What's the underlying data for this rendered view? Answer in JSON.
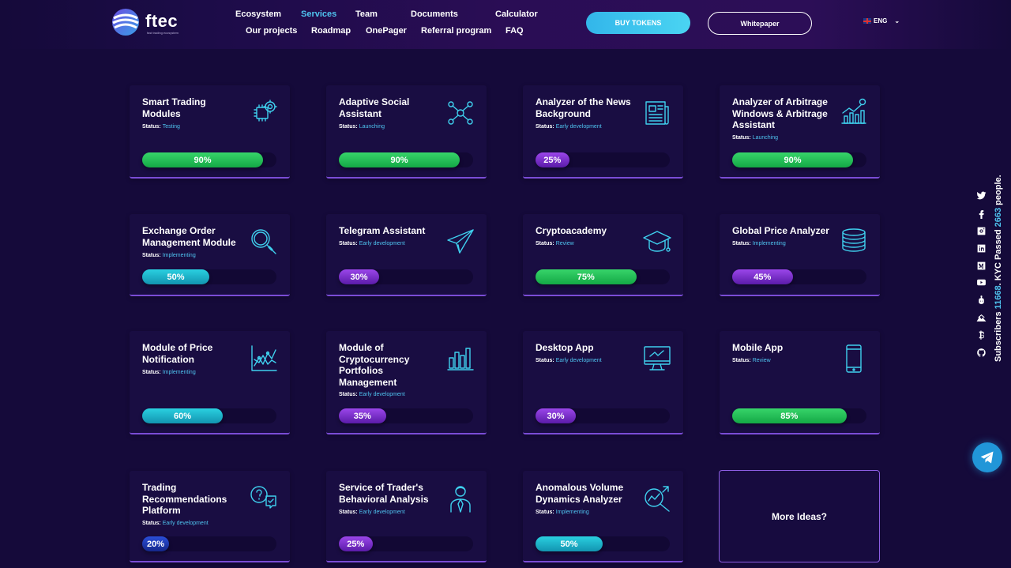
{
  "header": {
    "logo_text": "ftec",
    "logo_sub": "fast trading ecosystem",
    "nav": [
      {
        "label": "Ecosystem",
        "active": false
      },
      {
        "label": "Services",
        "active": true
      },
      {
        "label": "Team",
        "active": false
      },
      {
        "label": "Documents",
        "active": false
      },
      {
        "label": "Calculator",
        "active": false
      },
      {
        "label": "Our projects",
        "active": false
      },
      {
        "label": "Roadmap",
        "active": false
      },
      {
        "label": "OnePager",
        "active": false
      },
      {
        "label": "Referral program",
        "active": false
      },
      {
        "label": "FAQ",
        "active": false
      }
    ],
    "buy_label": "BUY TOKENS",
    "whitepaper_label": "Whitepaper",
    "lang": "ENG"
  },
  "status_prefix": "Status:",
  "cards": [
    {
      "title": "Smart Trading Modules",
      "status": "Testing",
      "progress": 90,
      "progress_label": "90%",
      "color": "green",
      "icon": "chip-gear-icon"
    },
    {
      "title": "Adaptive Social Assistant",
      "status": "Launching",
      "progress": 90,
      "progress_label": "90%",
      "color": "green",
      "icon": "network-icon"
    },
    {
      "title": "Analyzer of the News Background",
      "status": "Early development",
      "progress": 25,
      "progress_label": "25%",
      "color": "purple",
      "icon": "newspaper-icon"
    },
    {
      "title": "Analyzer of Arbitrage Windows & Arbitrage Assistant",
      "status": "Launching",
      "progress": 90,
      "progress_label": "90%",
      "color": "green",
      "icon": "growth-chart-icon"
    },
    {
      "title": "Exchange Order Management Module",
      "status": "Implementing",
      "progress": 50,
      "progress_label": "50%",
      "color": "cyan",
      "icon": "magnifier-icon"
    },
    {
      "title": "Telegram Assistant",
      "status": "Early development",
      "progress": 30,
      "progress_label": "30%",
      "color": "purple",
      "icon": "paper-plane-icon"
    },
    {
      "title": "Cryptoacademy",
      "status": "Review",
      "progress": 75,
      "progress_label": "75%",
      "color": "green",
      "icon": "graduation-cap-icon"
    },
    {
      "title": "Global Price Analyzer",
      "status": "Implementing",
      "progress": 45,
      "progress_label": "45%",
      "color": "purple",
      "icon": "coins-icon"
    },
    {
      "title": "Module of Price Notification",
      "status": "Implementing",
      "progress": 60,
      "progress_label": "60%",
      "color": "cyan",
      "icon": "line-chart-icon"
    },
    {
      "title": "Module of Cryptocurrency Portfolios Management",
      "status": "Early development",
      "progress": 35,
      "progress_label": "35%",
      "color": "purple",
      "icon": "bar-chart-icon"
    },
    {
      "title": "Desktop App",
      "status": "Early development",
      "progress": 30,
      "progress_label": "30%",
      "color": "purple",
      "icon": "monitor-icon"
    },
    {
      "title": "Mobile App",
      "status": "Review",
      "progress": 85,
      "progress_label": "85%",
      "color": "green",
      "icon": "smartphone-icon"
    },
    {
      "title": "Trading Recommendations Platform",
      "status": "Early development",
      "progress": 20,
      "progress_label": "20%",
      "color": "blue",
      "icon": "chat-question-icon"
    },
    {
      "title": "Service of Trader's Behavioral Analysis",
      "status": "Early development",
      "progress": 25,
      "progress_label": "25%",
      "color": "purple",
      "icon": "person-icon"
    },
    {
      "title": "Anomalous Volume Dynamics Analyzer",
      "status": "Implementing",
      "progress": 50,
      "progress_label": "50%",
      "color": "cyan",
      "icon": "magnifier-chart-icon"
    }
  ],
  "more_ideas": "More Ideas?",
  "social": [
    "twitter-icon",
    "facebook-icon",
    "instagram-icon",
    "linkedin-icon",
    "medium-icon",
    "youtube-icon",
    "reddit-icon",
    "mountain-icon",
    "bitcoin-icon",
    "github-icon"
  ],
  "sidebar_text": {
    "prefix": "Subscribers",
    "subscribers": "11668",
    "mid": ". KYC Passed",
    "kyc": "2663",
    "suffix": "people."
  },
  "accent_color": "#4fc3ef",
  "background_color": "#150a3a"
}
